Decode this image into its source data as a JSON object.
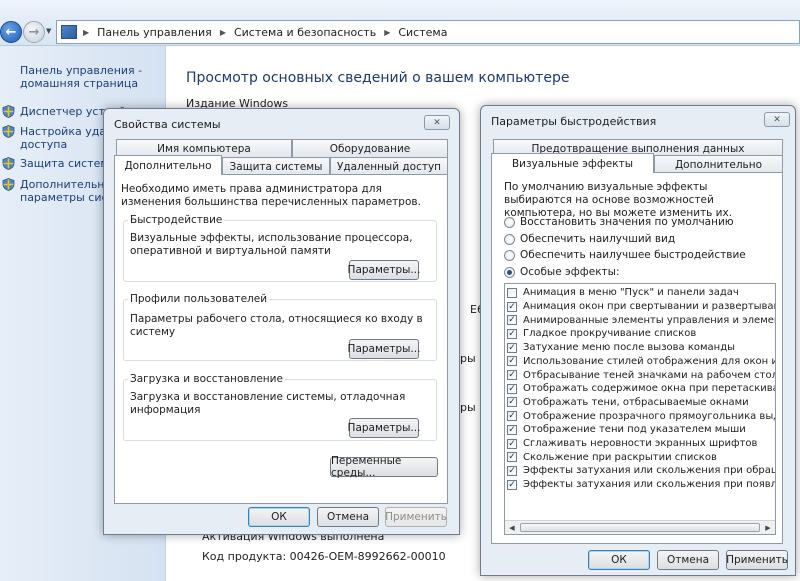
{
  "explorer": {
    "breadcrumbs": [
      "Панель управления",
      "Система и безопасность",
      "Система"
    ],
    "sidebar": {
      "home_link": "Панель управления - домашняя страница",
      "tasks": [
        {
          "label": "Диспетчер устройств",
          "icon": "shield-icon"
        },
        {
          "label": "Настройка удаленного доступа",
          "icon": "shield-icon"
        },
        {
          "label": "Защита системы",
          "icon": "shield-icon"
        },
        {
          "label": "Дополнительные параметры системы",
          "icon": "shield-icon"
        }
      ]
    },
    "main": {
      "title": "Просмотр основных сведений о вашем компьютере",
      "subtitle": "Издание Windows",
      "fragments": [
        "E6",
        "ры",
        "ры"
      ],
      "activation": "Активация Windows выполнена",
      "product_id": "Код продукта:  00426-OEM-8992662-00010"
    }
  },
  "system_properties": {
    "title": "Свойства системы",
    "close": "✕",
    "tabs_top": [
      "Имя компьютера",
      "Оборудование"
    ],
    "tabs_bottom": [
      "Дополнительно",
      "Защита системы",
      "Удаленный доступ"
    ],
    "active_tab": "Дополнительно",
    "admin_note": "Необходимо иметь права администратора для изменения большинства перечисленных параметров.",
    "groups": [
      {
        "label": "Быстродействие",
        "text": "Визуальные эффекты, использование процессора, оперативной и виртуальной памяти",
        "button": "Параметры..."
      },
      {
        "label": "Профили пользователей",
        "text": "Параметры рабочего стола, относящиеся ко входу в систему",
        "button": "Параметры..."
      },
      {
        "label": "Загрузка и восстановление",
        "text": "Загрузка и восстановление системы, отладочная информация",
        "button": "Параметры..."
      }
    ],
    "env_button": "Переменные среды...",
    "ok": "ОК",
    "cancel": "Отмена",
    "apply": "Применить"
  },
  "performance_options": {
    "title": "Параметры быстродействия",
    "close": "✕",
    "tab_top": "Предотвращение выполнения данных",
    "tabs_bottom": [
      "Визуальные эффекты",
      "Дополнительно"
    ],
    "active_tab": "Визуальные эффекты",
    "intro": "По умолчанию визуальные эффекты выбираются на основе возможностей компьютера, но вы можете изменить их.",
    "radios": [
      {
        "label": "Восстановить значения по умолчанию",
        "selected": false
      },
      {
        "label": "Обеспечить наилучший вид",
        "selected": false
      },
      {
        "label": "Обеспечить наилучшее быстродействие",
        "selected": false
      },
      {
        "label": "Особые эффекты:",
        "selected": true
      }
    ],
    "effects": [
      {
        "label": "Анимация в меню \"Пуск\" и панели задач",
        "checked": false
      },
      {
        "label": "Анимация окон при свертывании и развертывании",
        "checked": true
      },
      {
        "label": "Анимированные элементы управления и элементы внутри",
        "checked": true
      },
      {
        "label": "Гладкое прокручивание списков",
        "checked": true
      },
      {
        "label": "Затухание меню после вызова команды",
        "checked": true
      },
      {
        "label": "Использование стилей отображения для окон и кнопок",
        "checked": true
      },
      {
        "label": "Отбрасывание теней значками на рабочем столе",
        "checked": true
      },
      {
        "label": "Отображать содержимое окна при перетаскивании",
        "checked": true
      },
      {
        "label": "Отображать тени, отбрасываемые окнами",
        "checked": true
      },
      {
        "label": "Отображение прозрачного прямоугольника выделения",
        "checked": true
      },
      {
        "label": "Отображение тени под указателем мыши",
        "checked": true
      },
      {
        "label": "Сглаживать неровности экранных шрифтов",
        "checked": true
      },
      {
        "label": "Скольжение при раскрытии списков",
        "checked": true
      },
      {
        "label": "Эффекты затухания или скольжения при обращении к ме",
        "checked": true
      },
      {
        "label": "Эффекты затухания или скольжения при появлении подс",
        "checked": true
      }
    ],
    "ok": "ОК",
    "cancel": "Отмена",
    "apply": "Применить"
  }
}
